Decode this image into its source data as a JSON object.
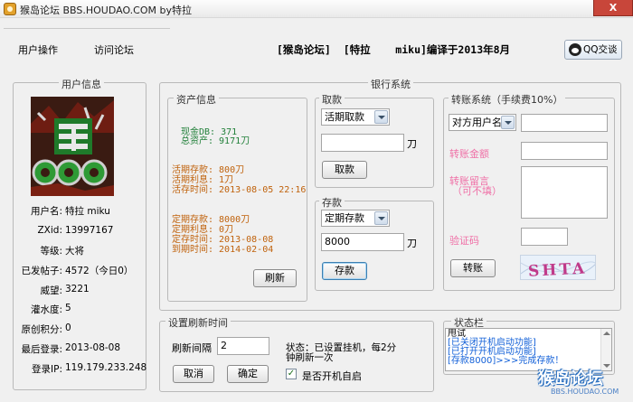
{
  "window": {
    "title": "猴岛论坛  BBS.HOUDAO.COM      by特拉",
    "close": "X"
  },
  "menu": {
    "user_ops": "用户操作",
    "visit_forum": "访问论坛"
  },
  "header": {
    "info": "[猴岛论坛]  [特拉    miku]编译于2013年8月",
    "qq_button": "QQ交谈"
  },
  "user_panel": {
    "legend": "用户信息",
    "fields": [
      {
        "label": "用户名:",
        "value": "特拉    miku"
      },
      {
        "label": "ZXid:",
        "value": "13997167"
      },
      {
        "label": "等级:",
        "value": "大将"
      },
      {
        "label": "已发帖子:",
        "value": "4572（今日0）"
      },
      {
        "label": "威望:",
        "value": "3221"
      },
      {
        "label": "灌水度:",
        "value": "5"
      },
      {
        "label": "原创积分:",
        "value": "0"
      },
      {
        "label": "最后登录:",
        "value": "2013-08-08"
      },
      {
        "label": "登录IP:",
        "value": "119.179.233.248"
      }
    ]
  },
  "bank": {
    "legend": "银行系统",
    "assets": {
      "legend": "资产信息",
      "cash": "现金DB: 371",
      "total": "总资产: 9171刀",
      "current_deposit": "活期存款: 800刀",
      "current_interest": "活期利息: 1刀",
      "current_time": "活存时间: 2013-08-05 22:16",
      "fixed_deposit": "定期存款: 8000刀",
      "fixed_interest": "定期利息: 0刀",
      "fixed_time": "定存时间: 2013-08-08",
      "fixed_due": "到期时间: 2014-02-04",
      "refresh_button": "刷新"
    },
    "withdraw": {
      "legend": "取款",
      "type": "活期取款",
      "amount": "",
      "unit": "刀",
      "button": "取款"
    },
    "deposit": {
      "legend": "存款",
      "type": "定期存款",
      "amount": "8000",
      "unit": "刀",
      "button": "存款"
    },
    "transfer": {
      "legend": "转账系统（手续费10%）",
      "target_type": "对方用户名",
      "target_value": "",
      "amount_label": "转账金额",
      "message_label": "转账留言",
      "message_hint": "（可不填）",
      "captcha_label": "验证码",
      "captcha_value": "",
      "captcha_text": "SHTA",
      "button": "转账"
    }
  },
  "refresh_settings": {
    "legend": "设置刷新时间",
    "interval_label": "刷新间隔",
    "interval_value": "2",
    "status_line1": "状态：已设置挂机，每2分",
    "status_line2": "钟刷新一次",
    "cancel_button": "取消",
    "confirm_button": "确定",
    "autostart_label": "是否开机自启",
    "autostart_checked": "✓"
  },
  "status_panel": {
    "legend": "状态栏",
    "lines": [
      "甩试",
      "[已关闭开机启动功能]",
      "[已打开开机启动功能]",
      "[存款8000]>>>完成存款！"
    ]
  },
  "watermark": {
    "main": "猴岛论坛",
    "sub": "BBS.HOUDAO.COM"
  }
}
